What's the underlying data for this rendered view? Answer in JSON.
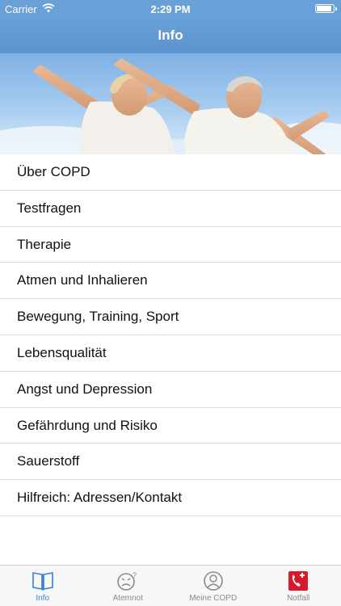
{
  "status_bar": {
    "carrier": "Carrier",
    "time": "2:29 PM",
    "battery_level": 0.9
  },
  "nav": {
    "title": "Info"
  },
  "hero": {
    "image": "senior-couple-outstretched-arms-sky-photo"
  },
  "menu": {
    "items": [
      "Über COPD",
      "Testfragen",
      "Therapie",
      "Atmen und Inhalieren",
      "Bewegung, Training, Sport",
      "Lebensqualität",
      "Angst und Depression",
      "Gefährdung und Risiko",
      "Sauerstoff",
      "Hilfreich: Adressen/Kontakt"
    ]
  },
  "tabs": [
    {
      "label": "Info",
      "icon": "book-icon",
      "active": true
    },
    {
      "label": "Atemnot",
      "icon": "breathless-face-icon",
      "active": false
    },
    {
      "label": "Meine COPD",
      "icon": "person-profile-icon",
      "active": false
    },
    {
      "label": "Notfall",
      "icon": "emergency-phone-icon",
      "active": false
    }
  ],
  "colors": {
    "nav_background": "#6aa0d8",
    "tab_active": "#3a7fd0",
    "tab_inactive": "#8a8a8a",
    "emergency_red": "#d7192a"
  }
}
